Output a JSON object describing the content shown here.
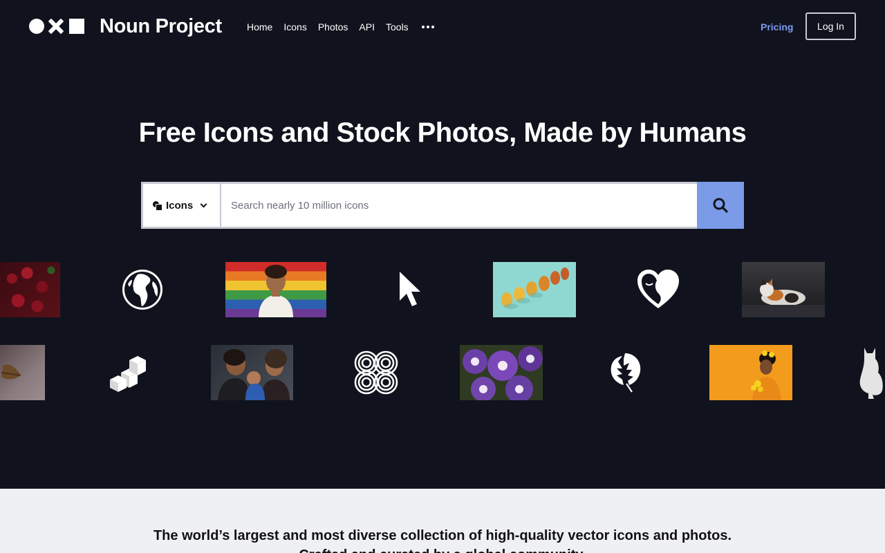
{
  "brand": {
    "logo_text": "Noun Project"
  },
  "nav": {
    "items": [
      "Home",
      "Icons",
      "Photos",
      "API",
      "Tools"
    ]
  },
  "header": {
    "pricing_label": "Pricing",
    "login_label": "Log In"
  },
  "hero": {
    "title": "Free Icons and Stock Photos, Made by Humans"
  },
  "search": {
    "type_label": "Icons",
    "placeholder": "Search nearly 10 million icons"
  },
  "footer_section": {
    "tagline": "The world’s largest and most diverse collection of high-quality vector icons and photos.",
    "tagline_second": "Crafted and curated by a global community."
  },
  "colors": {
    "background": "#10131d",
    "accent": "#7b9be9",
    "pricing": "#7d9bf0",
    "bottom_band": "#eff0f3"
  },
  "carousel": {
    "row1": [
      "cherries-photo",
      "globe-icon",
      "pride-flag-portrait-photo",
      "cursor-icon",
      "pears-photo",
      "heart-face-icon",
      "calico-cat-photo"
    ],
    "row2": [
      "dried-leaf-photo",
      "isometric-cubes-icon",
      "family-with-baby-photo",
      "concentric-circles-icon",
      "purple-petunias-photo",
      "monstera-leaf-icon",
      "woman-with-yellow-flowers-photo",
      "cat-silhouette-icon"
    ]
  }
}
